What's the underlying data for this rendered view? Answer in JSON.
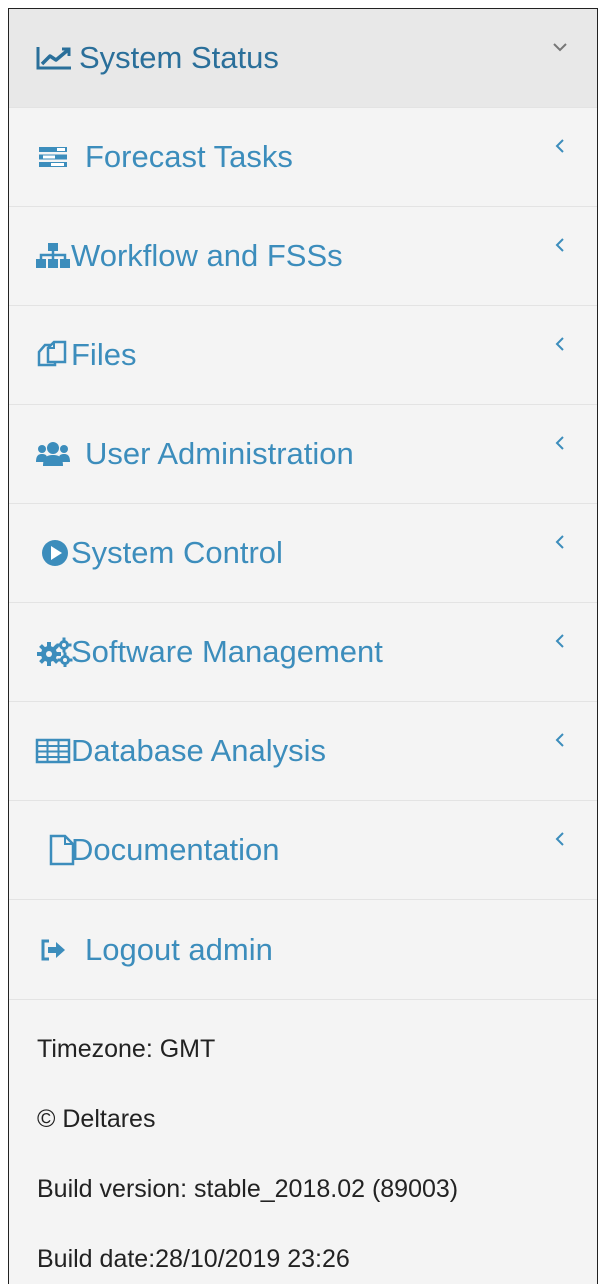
{
  "menu": {
    "items": [
      {
        "label": "System Status",
        "icon": "chart-line-icon",
        "state": "expanded"
      },
      {
        "label": "Forecast Tasks",
        "icon": "tasks-icon",
        "state": "collapsed"
      },
      {
        "label": "Workflow and FSSs",
        "icon": "sitemap-icon",
        "state": "collapsed"
      },
      {
        "label": "Files",
        "icon": "files-icon",
        "state": "collapsed"
      },
      {
        "label": "User Administration",
        "icon": "users-icon",
        "state": "collapsed"
      },
      {
        "label": "System Control",
        "icon": "play-circle-icon",
        "state": "collapsed"
      },
      {
        "label": "Software Management",
        "icon": "cogs-icon",
        "state": "collapsed"
      },
      {
        "label": "Database Analysis",
        "icon": "table-icon",
        "state": "collapsed"
      },
      {
        "label": "Documentation",
        "icon": "file-icon",
        "state": "collapsed"
      },
      {
        "label": "Logout admin",
        "icon": "sign-out-icon"
      }
    ]
  },
  "footer": {
    "timezone": "Timezone: GMT",
    "copyright": "© Deltares",
    "build_version": "Build version: stable_2018.02 (89003)",
    "build_date": "Build date:28/10/2019 23:26"
  },
  "colors": {
    "link": "#3c8dbc",
    "icon": "#3c8dbc",
    "active_bg": "#e8e8e8",
    "panel_bg": "#f4f4f4"
  }
}
